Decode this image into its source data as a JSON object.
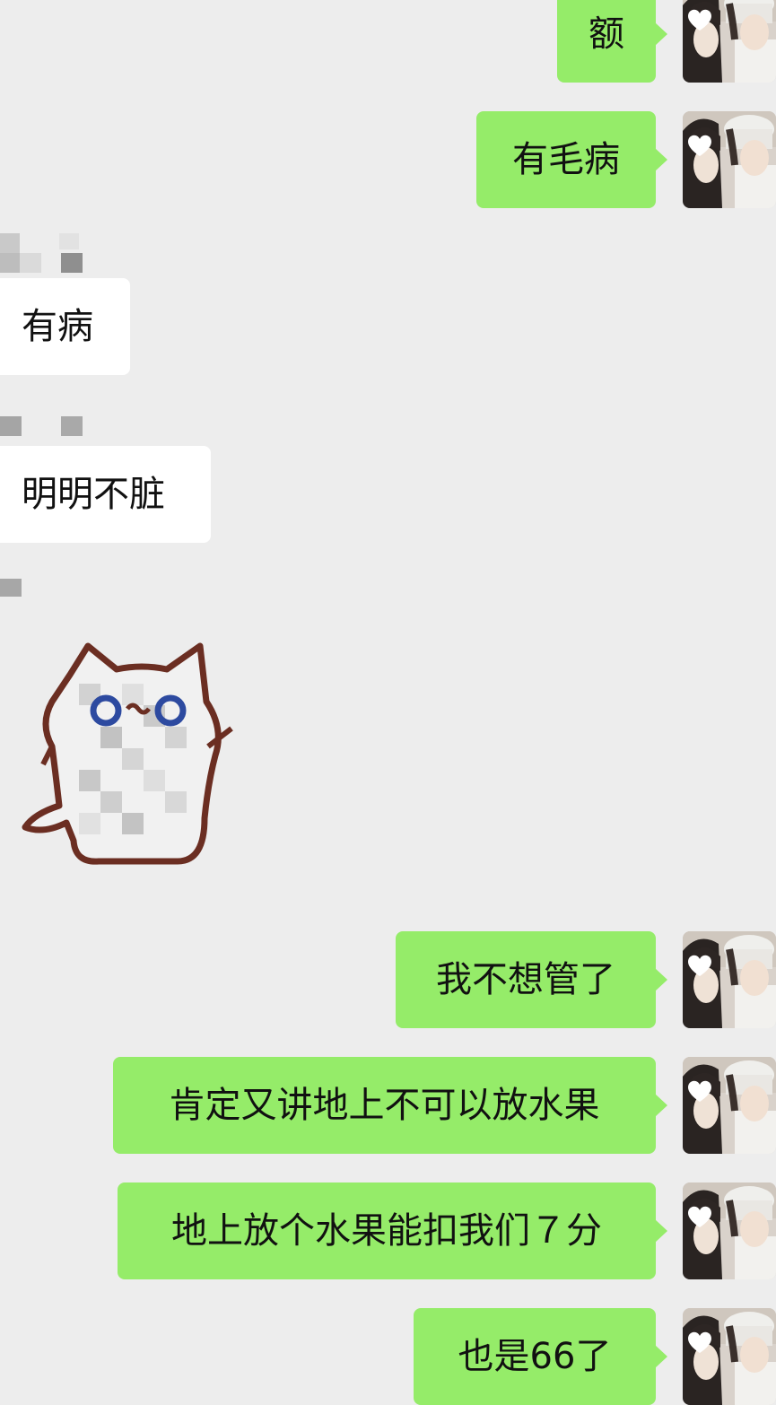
{
  "messages": [
    {
      "sender": "me",
      "text": "额"
    },
    {
      "sender": "me",
      "text": "有毛病"
    },
    {
      "sender": "them",
      "text": "有病"
    },
    {
      "sender": "them",
      "text": "明明不脏"
    },
    {
      "sender": "them",
      "sticker": "cat-sticker"
    },
    {
      "sender": "me",
      "text": "我不想管了"
    },
    {
      "sender": "me",
      "text": "肯定又讲地上不可以放水果"
    },
    {
      "sender": "me",
      "text": "地上放个水果能扣我们７分"
    },
    {
      "sender": "me",
      "text": "也是66了"
    }
  ],
  "colors": {
    "background": "#ededed",
    "self_bubble": "#95ec69",
    "other_bubble": "#ffffff"
  },
  "icons": {
    "self_avatar": "user-photo-avatar",
    "sticker": "cat-sticker"
  }
}
